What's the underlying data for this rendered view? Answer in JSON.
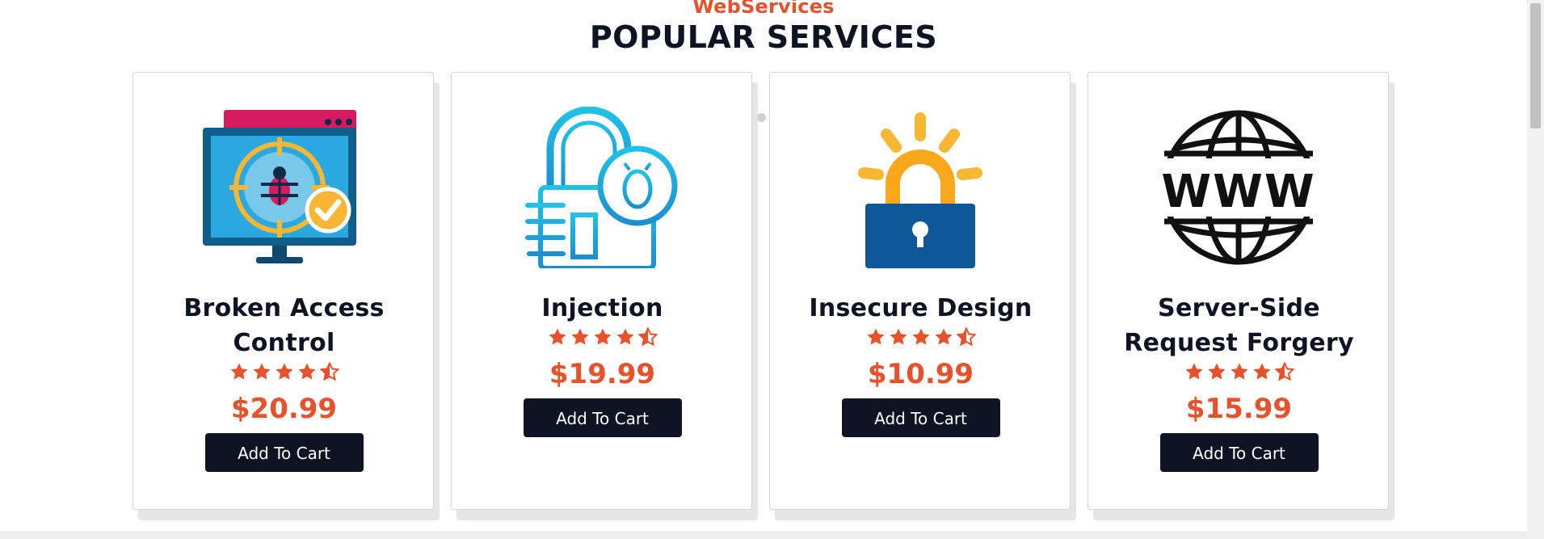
{
  "section": {
    "subtitle": "WebServices",
    "title": "POPULAR SERVICES"
  },
  "carousel": {
    "dots": 3,
    "active_index": 0
  },
  "services": [
    {
      "title": "Broken Access Control",
      "icon": "monitor-bug-target-icon",
      "rating": 4.5,
      "price": "$20.99",
      "cta": "Add To Cart"
    },
    {
      "title": "Injection",
      "icon": "padlock-bug-icon",
      "rating": 4.5,
      "price": "$19.99",
      "cta": "Add To Cart"
    },
    {
      "title": "Insecure Design",
      "icon": "glowing-padlock-icon",
      "rating": 4.5,
      "price": "$10.99",
      "cta": "Add To Cart"
    },
    {
      "title": "Server-Side Request Forgery",
      "icon": "www-globe-icon",
      "rating": 4.5,
      "price": "$15.99",
      "cta": "Add To Cart"
    }
  ],
  "colors": {
    "accent": "#e8512a",
    "dark": "#0e1424"
  }
}
